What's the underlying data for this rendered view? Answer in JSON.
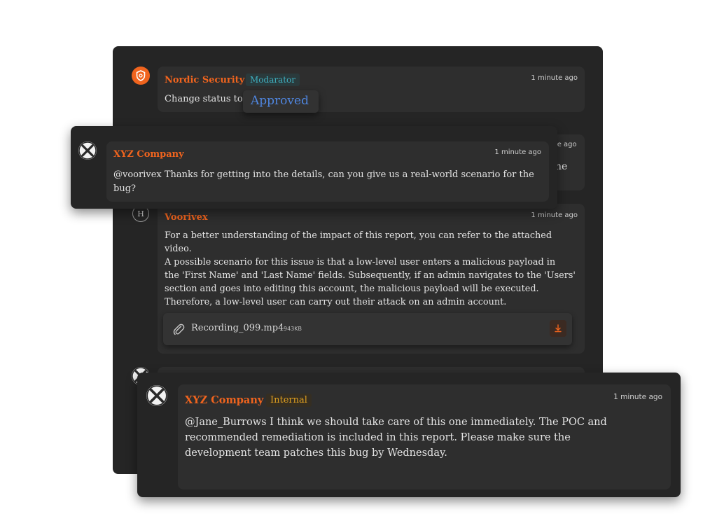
{
  "thread": {
    "comment1": {
      "author": "Nordic Security",
      "role": "Modarator",
      "time": "1 minute ago",
      "prefix": "Change status to",
      "status": "Approved"
    },
    "comment2": {
      "time_partial": "ite ago",
      "text_partial": "ne"
    },
    "comment3": {
      "avatar_letter": "H",
      "author": "Voorivex",
      "time": "1 minute ago",
      "lines": [
        "For a better understanding of the impact of this report, you can refer to the attached",
        "video.",
        "A possible scenario for this issue is that a low-level user enters a malicious payload in",
        "the 'First Name' and 'Last Name' fields. Subsequently, if an admin navigates to the 'Users'",
        "section and goes into editing this account, the malicious payload will be executed.",
        "Therefore, a low-level user can carry out their attack on an admin account."
      ],
      "attachment": {
        "name": "Recording_099.mp4",
        "size": "943KB",
        "icon": "paperclip-icon"
      }
    }
  },
  "popup_top": {
    "author": "XYZ Company",
    "time": "1 minute ago",
    "lines": [
      "@voorivex Thanks for getting into the details, can you give us a real-world scenario for the",
      "bug?"
    ]
  },
  "popup_bottom": {
    "author": "XYZ Company",
    "badge": "Internal",
    "time": "1 minute ago",
    "lines": [
      "@Jane_Burrows I think we should take care of this one immediately. The POC and",
      "recommended remediation is included in this report. Please make sure the",
      "development team patches this bug by Wednesday."
    ]
  },
  "colors": {
    "accent": "#f0641e",
    "moderator": "#3fb0c0",
    "approved": "#4f86e0",
    "internal_badge": "#e0a020"
  }
}
